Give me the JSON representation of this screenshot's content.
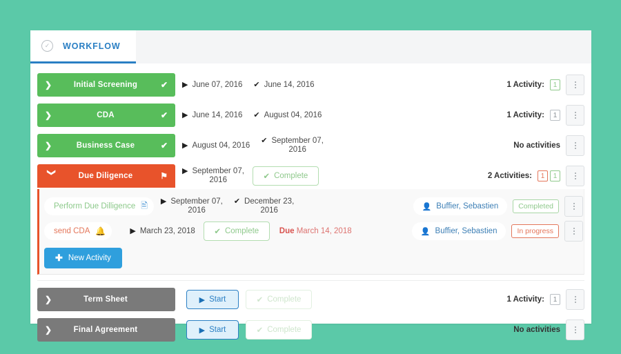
{
  "theme": {
    "page_background": "#5bc9a8",
    "green": "#58bd5b",
    "orange": "#e8532b",
    "gray": "#7a7a7a",
    "blue": "#2a7fc4",
    "new_activity_blue": "#2f9fdd"
  },
  "tab": {
    "label": "WORKFLOW",
    "icon": "check-circle-icon",
    "icon_glyph": "✓"
  },
  "icons": {
    "chevron_right": "❯",
    "chevron_down": "❯",
    "check": "✔",
    "flag": "⚑",
    "play": "▶",
    "plus": "✚",
    "user": "♟",
    "id_card": "▤",
    "bell": "ὑ4"
  },
  "stages": [
    {
      "name": "Initial Screening",
      "color": "green",
      "expanded": false,
      "marker": "check",
      "start_date": "June 07, 2016",
      "end_date": "June 14, 2016",
      "activity_label": "1 Activity:",
      "badges": [
        {
          "text": "1",
          "style": "green"
        }
      ]
    },
    {
      "name": "CDA",
      "color": "green",
      "expanded": false,
      "marker": "check",
      "start_date": "June 14, 2016",
      "end_date": "August 04, 2016",
      "activity_label": "1 Activity:",
      "badges": [
        {
          "text": "1",
          "style": "gray"
        }
      ]
    },
    {
      "name": "Business Case",
      "color": "green",
      "expanded": false,
      "marker": "check",
      "start_date": "August 04, 2016",
      "end_date": "September 07,\n2016",
      "activity_label": "No activities",
      "badges": []
    },
    {
      "name": "Due Diligence",
      "color": "orange",
      "expanded": true,
      "marker": "flag",
      "start_date": "September 07,\n2016",
      "complete_button": "Complete",
      "activity_label": "2 Activities:",
      "badges": [
        {
          "text": "1",
          "style": "red"
        },
        {
          "text": "1",
          "style": "green"
        }
      ]
    },
    {
      "name": "Term Sheet",
      "color": "gray",
      "expanded": false,
      "marker": "none",
      "start_button": "Start",
      "complete_button": "Complete",
      "activity_label": "1 Activity:",
      "badges": [
        {
          "text": "1",
          "style": "gray"
        }
      ]
    },
    {
      "name": "Final Agreement",
      "color": "gray",
      "expanded": false,
      "marker": "none",
      "start_button": "Start",
      "complete_button": "Complete",
      "activity_label": "No activities",
      "badges": []
    }
  ],
  "due_diligence_activities": [
    {
      "name": "Perform Due Dilligence",
      "name_style": "greenish",
      "icon": "id-card-icon",
      "start_date": "September 07,\n2016",
      "end_date": "December 23,\n2016",
      "assignee": "Buffier, Sebastien",
      "status": "Completed",
      "status_style": "completed"
    },
    {
      "name": "send CDA",
      "name_style": "redish",
      "icon": "bell-icon",
      "start_date": "March 23, 2018",
      "complete_button": "Complete",
      "due_label": "Due",
      "due_date": "March 14, 2018",
      "assignee": "Buffier, Sebastien",
      "status": "In progress",
      "status_style": "inprogress"
    }
  ],
  "new_activity_button": "New Activity"
}
